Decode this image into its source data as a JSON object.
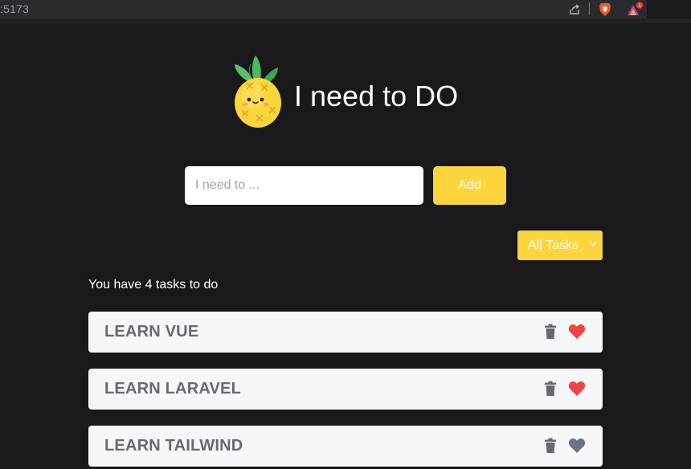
{
  "browser": {
    "url_fragment": ":5173",
    "icons": [
      "share-icon",
      "brave-shield-icon",
      "brave-rewards-icon"
    ],
    "rewards_badge": "1"
  },
  "header": {
    "title": "I need to DO",
    "logo_icon": "pineapple-icon"
  },
  "form": {
    "input_placeholder": "I need to ...",
    "input_value": "",
    "add_label": "Add"
  },
  "filter": {
    "selected": "All Tasks"
  },
  "summary": "You have 4 tasks to do",
  "tasks": [
    {
      "name": "LEARN VUE",
      "favorite": true
    },
    {
      "name": "LEARN LARAVEL",
      "favorite": true
    },
    {
      "name": "LEARN TAILWIND",
      "favorite": false
    }
  ],
  "colors": {
    "background": "#19181b",
    "accent": "#fcd53d",
    "favorite": "#ef4444",
    "not_favorite": "#6b7280",
    "task_text": "#646a74"
  }
}
